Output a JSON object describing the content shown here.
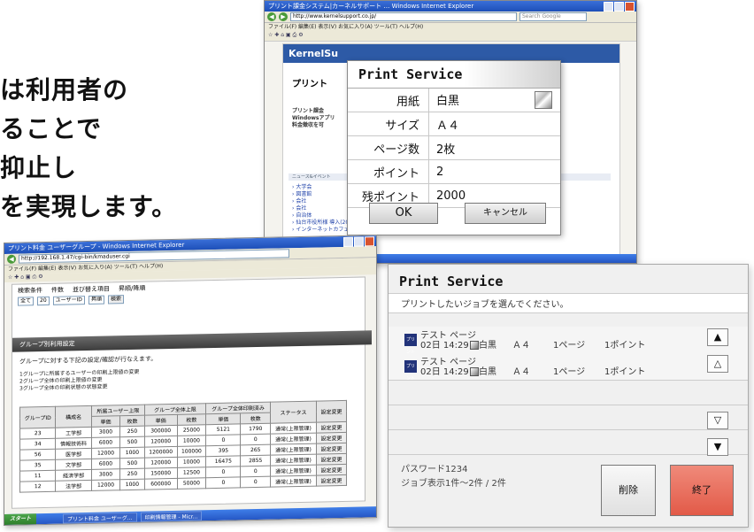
{
  "slogan": {
    "lines": [
      "は利用者の",
      "ることで",
      "抑止し",
      "を実現します。"
    ]
  },
  "top_browser": {
    "title": "プリント課金システム|カーネルサポート … Windows Internet Explorer",
    "menu": "ファイル(F)  編集(E)  表示(V)  お気に入り(A)  ツール(T)  ヘルプ(H)",
    "address": "http://www.kernelsupport.co.jp/",
    "search_placeholder": "Search Google",
    "banner": "KernelSu",
    "heading": "プリント",
    "body_lines": [
      "プリント課金",
      "Windowsアプリ",
      "料金徴収を可"
    ],
    "news_label": "ニュース&イベント",
    "list_items": [
      "大学会",
      "図書館",
      "会社",
      "会社",
      "自治体"
    ],
    "news_items": [
      "仙台市役所様 導入(2008/04)",
      "インターネットカフェ、プチカフェ様導入(2008/04)"
    ]
  },
  "print_dialog": {
    "title": "Print Service",
    "rows": [
      {
        "key": "用紙",
        "value": "白黒"
      },
      {
        "key": "サイズ",
        "value": "Ａ４"
      },
      {
        "key": "ページ数",
        "value": "2枚"
      },
      {
        "key": "ポイント",
        "value": "2"
      },
      {
        "key": "残ポイント",
        "value": "2000"
      }
    ],
    "ok_label": "OK",
    "cancel_label": "キャンセル"
  },
  "admin_window": {
    "title": "プリント料金 ユーザーグループ - Windows Internet Explorer",
    "address": "http://192.168.1.47/cgi-bin/kmaduser.cgi",
    "menu": "ファイル(F)  編集(E)  表示(V)  お気に入り(A)  ツール(T)  ヘルプ(H)",
    "search_labels": [
      "検索条件",
      "件数",
      "並び替え項目",
      "昇順/降順"
    ],
    "search_values": [
      "全て",
      "20",
      "ユーザーID",
      "昇順"
    ],
    "search_button": "検索",
    "section_title": "グループ別利用設定",
    "desc": "グループに対する下記の設定/確認が行なえます。",
    "bullets": [
      "1グループに所属するユーザーの印刷上限値の変更",
      "2グループ全体の印刷上限値の変更",
      "3グループ全体の印刷状態の状態変更"
    ],
    "headers_top": [
      "グループID",
      "構成名",
      "所属ユーザー上限",
      "グループ全体上限",
      "グループ全体印刷済み",
      "ステータス",
      "設定変更"
    ],
    "headers_sub": [
      "単価",
      "枚数",
      "単価",
      "枚数",
      "単価",
      "枚数"
    ],
    "rows": [
      [
        "23",
        "工学部",
        "3000",
        "250",
        "300000",
        "25000",
        "5121",
        "1790",
        "通常(上限管理)",
        "設定変更"
      ],
      [
        "34",
        "情報技術科",
        "6000",
        "500",
        "120000",
        "10000",
        "0",
        "0",
        "通常(上限管理)",
        "設定変更"
      ],
      [
        "56",
        "医学部",
        "12000",
        "1000",
        "1200000",
        "100000",
        "395",
        "265",
        "通常(上限管理)",
        "設定変更"
      ],
      [
        "35",
        "文学部",
        "6000",
        "500",
        "120000",
        "10000",
        "16475",
        "2855",
        "通常(上限管理)",
        "設定変更"
      ],
      [
        "11",
        "経済学部",
        "3000",
        "250",
        "150000",
        "12500",
        "0",
        "0",
        "通常(上限管理)",
        "設定変更"
      ],
      [
        "12",
        "法学部",
        "12000",
        "1000",
        "600000",
        "50000",
        "0",
        "0",
        "通常(上限管理)",
        "設定変更"
      ]
    ],
    "taskbar_start": "スタート",
    "taskbar_items": [
      "プリント料金 ユーザーグ...",
      "印刷情報管理 - Micr..."
    ]
  },
  "job_panel": {
    "title": "Print Service",
    "prompt": "プリントしたいジョブを選んでください。",
    "jobs": [
      {
        "icon": "プリント",
        "name": "テスト ページ",
        "date": "02日 14:29",
        "color": "白黒",
        "size": "Ａ４",
        "pages": "1ページ",
        "points": "1ポイント"
      },
      {
        "icon": "プリント",
        "name": "テスト ページ",
        "date": "02日 14:29",
        "color": "白黒",
        "size": "Ａ４",
        "pages": "1ページ",
        "points": "1ポイント"
      }
    ],
    "password": "パスワード1234",
    "count": "ジョブ表示1件～2件 / 2件",
    "delete_label": "削除",
    "exit_label": "終了",
    "exit_color": "#f08a7a"
  }
}
